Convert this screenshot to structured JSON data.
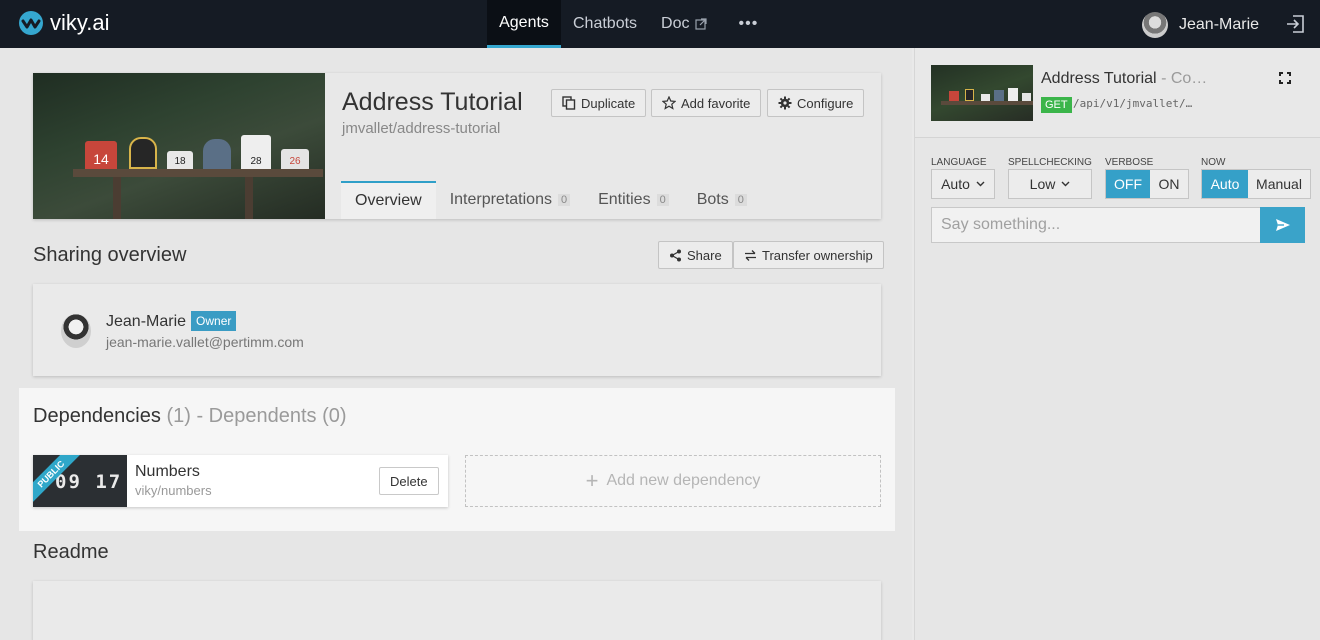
{
  "app": {
    "name": "viky.ai"
  },
  "nav": {
    "agents": "Agents",
    "chatbots": "Chatbots",
    "doc": "Doc",
    "more": "•••"
  },
  "user": {
    "name": "Jean-Marie"
  },
  "agent": {
    "title": "Address Tutorial",
    "slug": "jmvallet/address-tutorial",
    "image_numbers": [
      "14",
      "18",
      "28",
      "26"
    ]
  },
  "actions": {
    "duplicate": "Duplicate",
    "add_favorite": "Add favorite",
    "configure": "Configure"
  },
  "tabs": [
    {
      "label": "Overview"
    },
    {
      "label": "Interpretations",
      "count": "0"
    },
    {
      "label": "Entities",
      "count": "0"
    },
    {
      "label": "Bots",
      "count": "0"
    }
  ],
  "sharing": {
    "title": "Sharing overview",
    "share": "Share",
    "transfer": "Transfer ownership",
    "owner": {
      "name": "Jean-Marie",
      "badge": "Owner",
      "email": "jean-marie.vallet@pertimm.com"
    }
  },
  "dependencies": {
    "title": "Dependencies",
    "count": "(1)",
    "separator": "- Dependents",
    "dependents_count": "(0)",
    "items": [
      {
        "name": "Numbers",
        "slug": "viky/numbers",
        "ribbon": "PUBLIC",
        "thumb_digits": "09 17",
        "delete": "Delete"
      }
    ],
    "add_label": "Add new dependency"
  },
  "readme": {
    "title": "Readme"
  },
  "console": {
    "title": "Address Tutorial",
    "title_suffix": "- Co…",
    "method": "GET",
    "endpoint": "/api/v1/jmvallet/…",
    "language": {
      "label": "LANGUAGE",
      "value": "Auto"
    },
    "spellchecking": {
      "label": "SPELLCHECKING",
      "value": "Low"
    },
    "verbose": {
      "label": "VERBOSE",
      "off": "OFF",
      "on": "ON",
      "selected": "OFF"
    },
    "now": {
      "label": "NOW",
      "auto": "Auto",
      "manual": "Manual",
      "selected": "Auto"
    },
    "input_placeholder": "Say something..."
  },
  "colors": {
    "accent": "#35a0c8",
    "topbar": "#151b24",
    "get": "#3bb54a"
  }
}
